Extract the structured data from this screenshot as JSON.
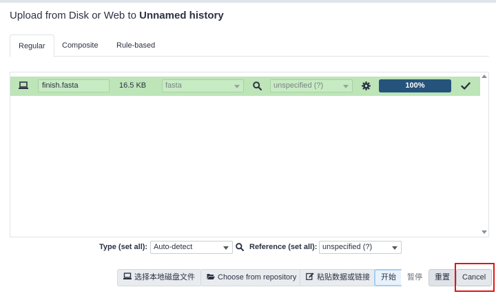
{
  "dialog": {
    "title_prefix": "Upload from Disk or Web to",
    "history_name": "Unnamed history"
  },
  "tabs": [
    {
      "label": "Regular",
      "active": true
    },
    {
      "label": "Composite",
      "active": false
    },
    {
      "label": "Rule-based",
      "active": false
    }
  ],
  "file_row": {
    "name": "finish.fasta",
    "size": "16.5 KB",
    "type": "fasta",
    "reference": "unspecified (?)",
    "progress_label": "100%",
    "progress_percent": 100,
    "status": "success",
    "row_color": "#bde5b8"
  },
  "settings": {
    "type_label": "Type (set all):",
    "type_value": "Auto-detect",
    "reference_label": "Reference (set all):",
    "reference_value": "unspecified (?)"
  },
  "footer": {
    "local_files_label": "选择本地磁盘文件",
    "repository_label": "Choose from repository",
    "paste_label": "粘贴数据或链接",
    "start_label": "开始",
    "pause_label": "暂停",
    "reset_label": "重置",
    "cancel_label": "Cancel"
  },
  "icons": [
    "laptop-icon",
    "search-icon",
    "gear-icon",
    "check-icon",
    "folder-open-icon",
    "edit-icon"
  ],
  "colors": {
    "success_row": "#bde5b8",
    "progress_bar": "#25537b",
    "primary_text": "#2c3143",
    "highlight": "#e01414"
  }
}
